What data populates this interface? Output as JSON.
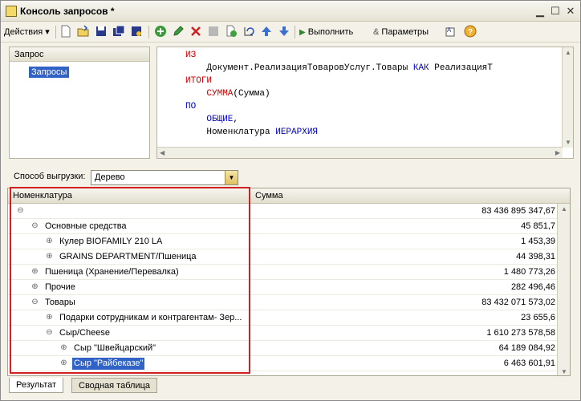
{
  "window": {
    "title": "Консоль запросов *"
  },
  "toolbar": {
    "actions_label": "Действия",
    "execute_label": "Выполнить",
    "params_label": "Параметры"
  },
  "tree": {
    "header": "Запрос",
    "items": [
      {
        "label": "Запросы",
        "selected": true
      }
    ]
  },
  "editor": {
    "lines": [
      {
        "parts": [
          {
            "t": "ИЗ",
            "c": "kw"
          }
        ]
      },
      {
        "parts": [
          {
            "t": "    Документ.РеализацияТоваровУслуг.Товары ",
            "c": ""
          },
          {
            "t": "КАК",
            "c": "kb"
          },
          {
            "t": " РеализацияТ",
            "c": ""
          }
        ]
      },
      {
        "parts": [
          {
            "t": "ИТОГИ",
            "c": "kw"
          }
        ]
      },
      {
        "parts": [
          {
            "t": "    ",
            "c": ""
          },
          {
            "t": "СУММА",
            "c": "kw"
          },
          {
            "t": "(Сумма)",
            "c": ""
          }
        ]
      },
      {
        "parts": [
          {
            "t": "ПО",
            "c": "kb"
          }
        ]
      },
      {
        "parts": [
          {
            "t": "    ",
            "c": ""
          },
          {
            "t": "ОБЩИЕ",
            "c": "kb"
          },
          {
            "t": ",",
            "c": ""
          }
        ]
      },
      {
        "parts": [
          {
            "t": "    Номенклатура ",
            "c": ""
          },
          {
            "t": "ИЕРАРХИЯ",
            "c": "kb"
          }
        ]
      }
    ]
  },
  "options": {
    "export_label": "Способ выгрузки:",
    "export_value": "Дерево"
  },
  "grid": {
    "columns": [
      "Номенклатура",
      "Сумма"
    ],
    "rows": [
      {
        "level": 0,
        "toggle": "minus",
        "label": "",
        "sum": "83 436 895 347,67"
      },
      {
        "level": 1,
        "toggle": "minus",
        "label": "Основные средства",
        "sum": "45 851,7"
      },
      {
        "level": 2,
        "toggle": "plus",
        "label": "Кулер BIOFAMILY 210 LA",
        "sum": "1 453,39"
      },
      {
        "level": 2,
        "toggle": "plus",
        "label": "GRAINS DEPARTMENT/Пшеница",
        "sum": "44 398,31"
      },
      {
        "level": 1,
        "toggle": "plus",
        "label": "Пшеница (Хранение/Перевалка)",
        "sum": "1 480 773,26"
      },
      {
        "level": 1,
        "toggle": "plus",
        "label": "Прочие",
        "sum": "282 496,46"
      },
      {
        "level": 1,
        "toggle": "minus",
        "label": "Товары",
        "sum": "83 432 071 573,02"
      },
      {
        "level": 2,
        "toggle": "plus",
        "label": "Подарки сотрудникам и контрагентам- Зер...",
        "sum": "23 655,6"
      },
      {
        "level": 2,
        "toggle": "minus",
        "label": "Сыр/Cheese",
        "sum": "1 610 273 578,58"
      },
      {
        "level": 3,
        "toggle": "plus",
        "label": "Сыр \"Швейцарский\"",
        "sum": "64 189 084,92"
      },
      {
        "level": 3,
        "toggle": "plus",
        "label": "Сыр \"Райбеказе\"",
        "sum": "6 463 601,91",
        "selected": true
      }
    ]
  },
  "tabs": [
    {
      "label": "Результат",
      "active": true
    },
    {
      "label": "Сводная таблица",
      "active": false
    }
  ]
}
